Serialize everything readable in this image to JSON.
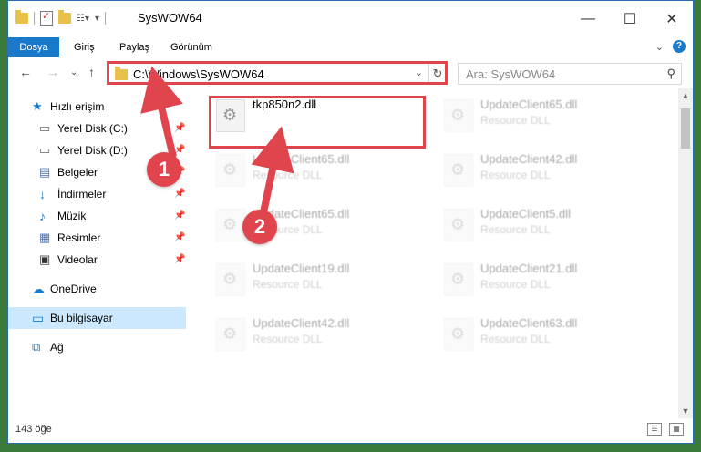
{
  "window": {
    "title": "SysWOW64",
    "minimize_label": "—",
    "maximize_label": "☐",
    "close_label": "✕"
  },
  "ribbon": {
    "tabs": [
      {
        "label": "Dosya",
        "active": true
      },
      {
        "label": "Giriş",
        "active": false
      },
      {
        "label": "Paylaş",
        "active": false
      },
      {
        "label": "Görünüm",
        "active": false
      }
    ],
    "expand_label": "⌄",
    "help_label": "?"
  },
  "nav": {
    "back_label": "←",
    "forward_label": "→",
    "recent_label": "⌄",
    "up_label": "↑",
    "address": "C:\\Windows\\SysWOW64",
    "address_dropdown": "⌄",
    "refresh_label": "↻",
    "search_placeholder": "Ara: SysWOW64",
    "search_icon": "⚲"
  },
  "sidebar": {
    "items": [
      {
        "label": "Hızlı erişim",
        "icon": "star-icon",
        "glyph": "★",
        "color": "#1979ca",
        "pinned": false
      },
      {
        "label": "Yerel Disk (C:)",
        "icon": "drive-icon",
        "glyph": "▭",
        "color": "#666666",
        "pinned": true
      },
      {
        "label": "Yerel Disk (D:)",
        "icon": "drive-icon",
        "glyph": "▭",
        "color": "#666666",
        "pinned": true
      },
      {
        "label": "Belgeler",
        "icon": "documents-icon",
        "glyph": "▤",
        "color": "#4a6fa5",
        "pinned": true
      },
      {
        "label": "İndirmeler",
        "icon": "download-icon",
        "glyph": "↓",
        "color": "#1979ca",
        "pinned": true
      },
      {
        "label": "Müzik",
        "icon": "music-icon",
        "glyph": "♪",
        "color": "#1979ca",
        "pinned": true
      },
      {
        "label": "Resimler",
        "icon": "pictures-icon",
        "glyph": "▦",
        "color": "#4a6fa5",
        "pinned": true
      },
      {
        "label": "Videolar",
        "icon": "video-icon",
        "glyph": "▣",
        "color": "#333333",
        "pinned": true
      },
      {
        "label": "OneDrive",
        "icon": "cloud-icon",
        "glyph": "☁",
        "color": "#1979ca",
        "pinned": false
      },
      {
        "label": "Bu bilgisayar",
        "icon": "computer-icon",
        "glyph": "▭",
        "color": "#1979ca",
        "pinned": false
      },
      {
        "label": "Ağ",
        "icon": "network-icon",
        "glyph": "⧉",
        "color": "#1979ca",
        "pinned": false
      }
    ],
    "pin_glyph": "📌"
  },
  "files": {
    "selected": {
      "name": "tkp850n2.dll",
      "type": ""
    },
    "others": [
      {
        "name": "UpdateClient65.dll",
        "type": "Resource DLL"
      },
      {
        "name": "UpdateClient65.dll",
        "type": "Resource DLL"
      },
      {
        "name": "UpdateClient42.dll",
        "type": "Resource DLL"
      },
      {
        "name": "UpdateClient65.dll",
        "type": "Resource DLL"
      },
      {
        "name": "UpdateClient5.dll",
        "type": "Resource DLL"
      },
      {
        "name": "UpdateClient19.dll",
        "type": "Resource DLL"
      },
      {
        "name": "UpdateClient21.dll",
        "type": "Resource DLL"
      },
      {
        "name": "UpdateClient42.dll",
        "type": "Resource DLL"
      },
      {
        "name": "UpdateClient63.dll",
        "type": "Resource DLL"
      }
    ]
  },
  "status": {
    "count": "143 öğe"
  },
  "annotations": {
    "badge1": "1",
    "badge2": "2",
    "color": "#e0454e"
  }
}
